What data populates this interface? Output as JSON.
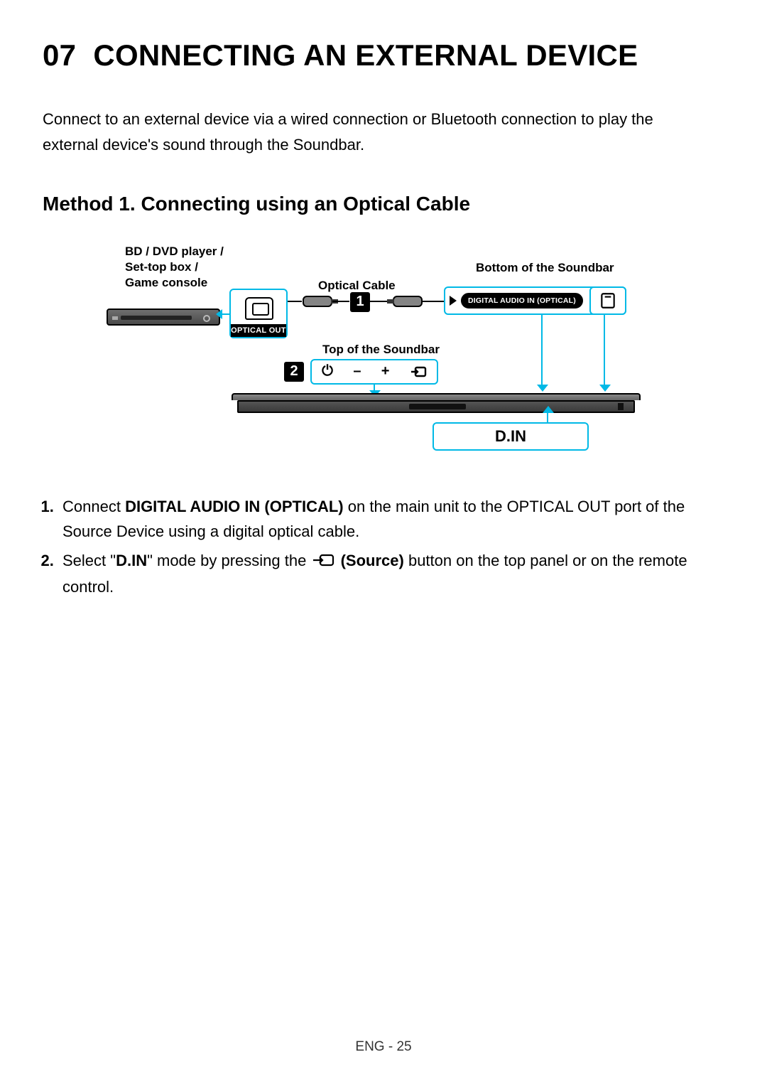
{
  "section_number": "07",
  "section_title": "CONNECTING AN EXTERNAL DEVICE",
  "intro": "Connect to an external device via a wired connection or Bluetooth connection to play the external device's sound through the Soundbar.",
  "method_heading": "Method 1. Connecting using an Optical Cable",
  "diagram": {
    "source_label_line1": "BD / DVD player /",
    "source_label_line2": "Set-top box /",
    "source_label_line3": "Game console",
    "bottom_label": "Bottom of the Soundbar",
    "optical_cable_label": "Optical Cable",
    "top_label": "Top of the Soundbar",
    "optical_out_label": "OPTICAL OUT",
    "digital_audio_in_label": "DIGITAL AUDIO IN (OPTICAL)",
    "badge1": "1",
    "badge2": "2",
    "din_text": "D.IN",
    "top_buttons": {
      "power": "⏻",
      "minus": "–",
      "plus": "+"
    }
  },
  "steps": {
    "s1_num": "1.",
    "s1_pre": "Connect ",
    "s1_bold": "DIGITAL AUDIO IN (OPTICAL)",
    "s1_post": " on the main unit to the OPTICAL OUT port of the Source Device using a digital optical cable.",
    "s2_num": "2.",
    "s2_pre": "Select \"",
    "s2_bold1": "D.IN",
    "s2_mid": "\" mode by pressing the ",
    "s2_bold2": "(Source)",
    "s2_post": " button on the top panel or on the remote control."
  },
  "footer": "ENG - 25"
}
